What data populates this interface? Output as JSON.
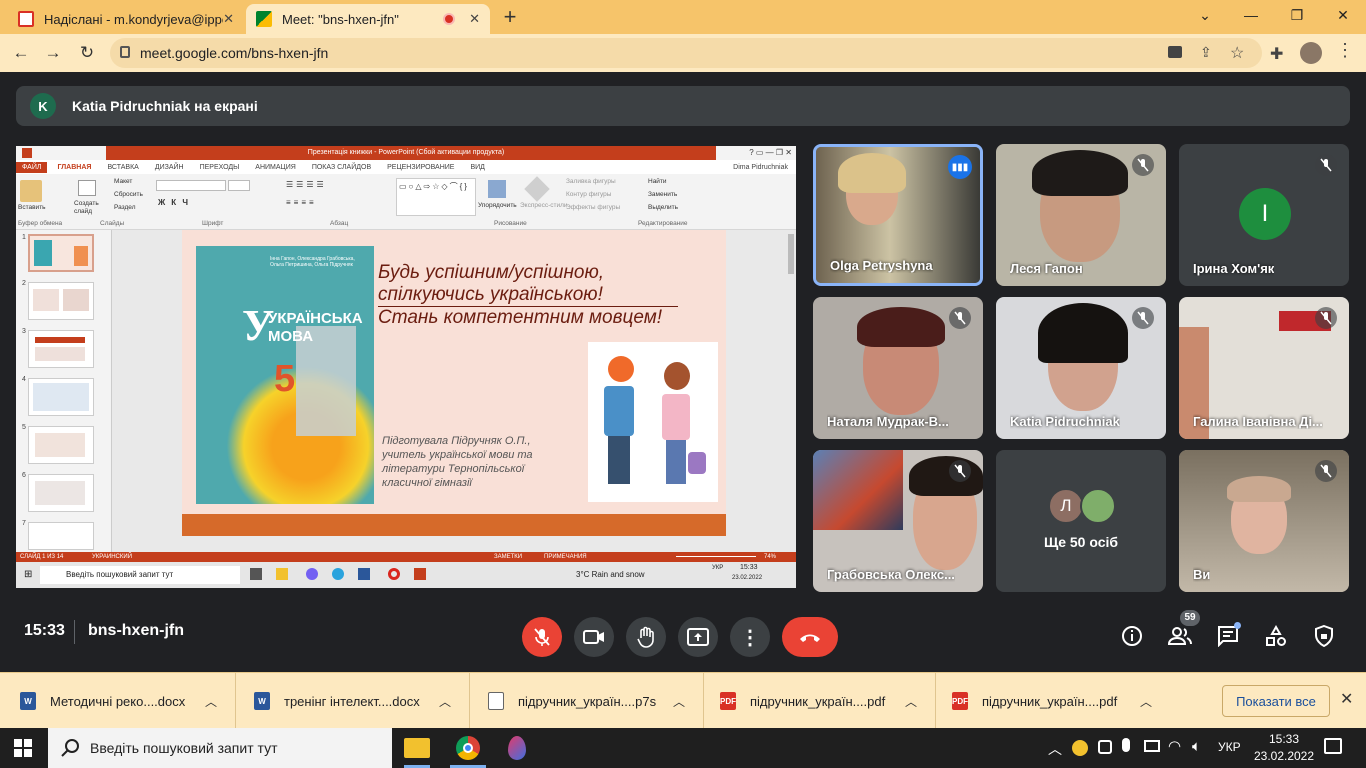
{
  "browser": {
    "tabs": [
      {
        "title": "Надіслані - m.kondyrjeva@ippo.",
        "active": false
      },
      {
        "title": "Meet: \"bns-hxen-jfn\"",
        "active": true
      }
    ],
    "url": "meet.google.com/bns-hxen-jfn",
    "new_tab": "+",
    "close_tab": "✕"
  },
  "meet": {
    "presenter_initial": "K",
    "presenter_banner": "Katia Pidruchniak на екрані",
    "time": "15:33",
    "meeting_code": "bns-hxen-jfn",
    "participants_count": "59",
    "participants": [
      {
        "name": "Olga Petryshyna",
        "speaking": true
      },
      {
        "name": "Леся Гапон",
        "muted": true
      },
      {
        "name": "Ірина Хом'як",
        "initial": "І",
        "muted": true
      },
      {
        "name": "Наталя Мудрак-В...",
        "muted": true
      },
      {
        "name": "Katia Pidruchniak",
        "muted": true
      },
      {
        "name": "Галина Іванівна Ді...",
        "muted": true
      },
      {
        "name": "Грабовська Олекс...",
        "muted": true
      },
      {
        "name": "Ще 50 осіб",
        "initial": "Л"
      },
      {
        "name": "Ви",
        "muted": true
      }
    ]
  },
  "presentation": {
    "window_title": "Презентація книжки - PowerPoint (Сбой активации продукта)",
    "ribbon_tabs": [
      "ФАЙЛ",
      "ГЛАВНАЯ",
      "ВСТАВКА",
      "ДИЗАЙН",
      "ПЕРЕХОДЫ",
      "АНИМАЦИЯ",
      "ПОКАЗ СЛАЙДОВ",
      "РЕЦЕНЗИРОВАНИЕ",
      "ВИД"
    ],
    "user": "Dima Pidruchniak",
    "ribbon_groups": [
      "Буфер обмена",
      "Слайды",
      "Шрифт",
      "Абзац",
      "Рисование",
      "Редактирование"
    ],
    "ribbon_buttons": [
      "Вставить",
      "Создать слайд",
      "Макет",
      "Сбросить",
      "Раздел",
      "Упорядочить",
      "Экспресс-стили",
      "Заливка фигуры",
      "Контур фигуры",
      "Эффекты фигуры",
      "Найти",
      "Заменить",
      "Выделить"
    ],
    "slide_numbers": [
      "1",
      "2",
      "3",
      "4",
      "5",
      "6",
      "7"
    ],
    "slide_heading_lines": [
      "Будь успішним/успішною,",
      "спілкуючись українською!",
      "Стань компетентним мовцем!"
    ],
    "book_title_top": "УКРАЇНСЬКА",
    "book_title_bottom": "МОВА",
    "book_letter": "У",
    "book_number": "5",
    "book_authors": "Інна Гапон, Олександра Грабовська, Ольга Петришина, Ольга Підручняк",
    "prepared_by_lines": [
      "Підготувала Підручняк О.П.,",
      "учитель української мови та",
      "літератури Тернопільської",
      "класичної гімназії"
    ],
    "status_left": "СЛАЙД 1 ИЗ 14",
    "status_lang": "УКРАИНСКИЙ",
    "status_notes": "ЗАМЕТКИ",
    "status_comments": "ПРИМЕЧАНИЯ",
    "zoom": "74%",
    "inner_taskbar_search": "Введіть пошуковий запит тут",
    "inner_weather": "3°C  Rain and snow",
    "inner_time": "15:33",
    "inner_date": "23.02.2022",
    "inner_lang": "УКР"
  },
  "downloads": {
    "items": [
      {
        "name": "Методичні реко....docx",
        "type": "word"
      },
      {
        "name": "тренінг інтелект....docx",
        "type": "word"
      },
      {
        "name": "підручник_україн....p7s",
        "type": "file"
      },
      {
        "name": "підручник_україн....pdf",
        "type": "pdf"
      },
      {
        "name": "підручник_україн....pdf",
        "type": "pdf"
      }
    ],
    "show_all": "Показати все"
  },
  "taskbar": {
    "search": "Введіть пошуковий запит тут",
    "lang": "УКР",
    "time": "15:33",
    "date": "23.02.2022"
  },
  "colors": {
    "chrome_frame": "#f6c46a",
    "meet_bg": "#202124",
    "end_call": "#ea4335",
    "ppt_accent": "#c43e1c"
  }
}
